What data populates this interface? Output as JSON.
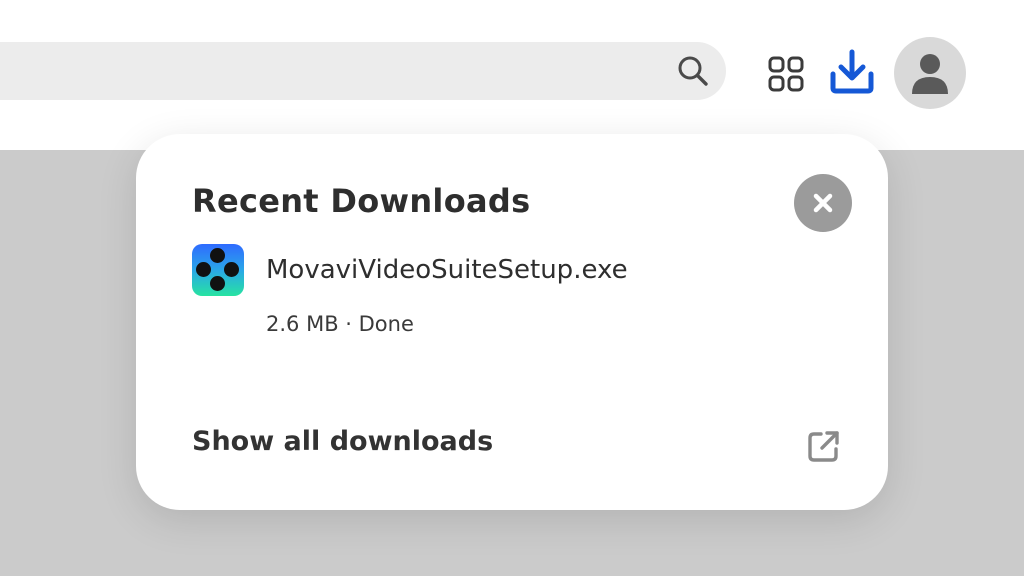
{
  "toolbar": {
    "search_icon": "search-icon",
    "apps_icon": "apps-grid-icon",
    "download_icon": "download-icon",
    "avatar_icon": "user-icon",
    "accent_color": "#1558d6"
  },
  "downloads_panel": {
    "title": "Recent Downloads",
    "close_icon": "close-icon",
    "items": [
      {
        "file_name": "MovaviVideoSuiteSetup.exe",
        "size": "2.6 MB",
        "separator": "·",
        "status": "Done",
        "meta_text": "2.6 MB · Done",
        "icon": "movavi-app-icon"
      }
    ],
    "show_all_label": "Show all downloads",
    "external_icon": "open-external-icon"
  }
}
